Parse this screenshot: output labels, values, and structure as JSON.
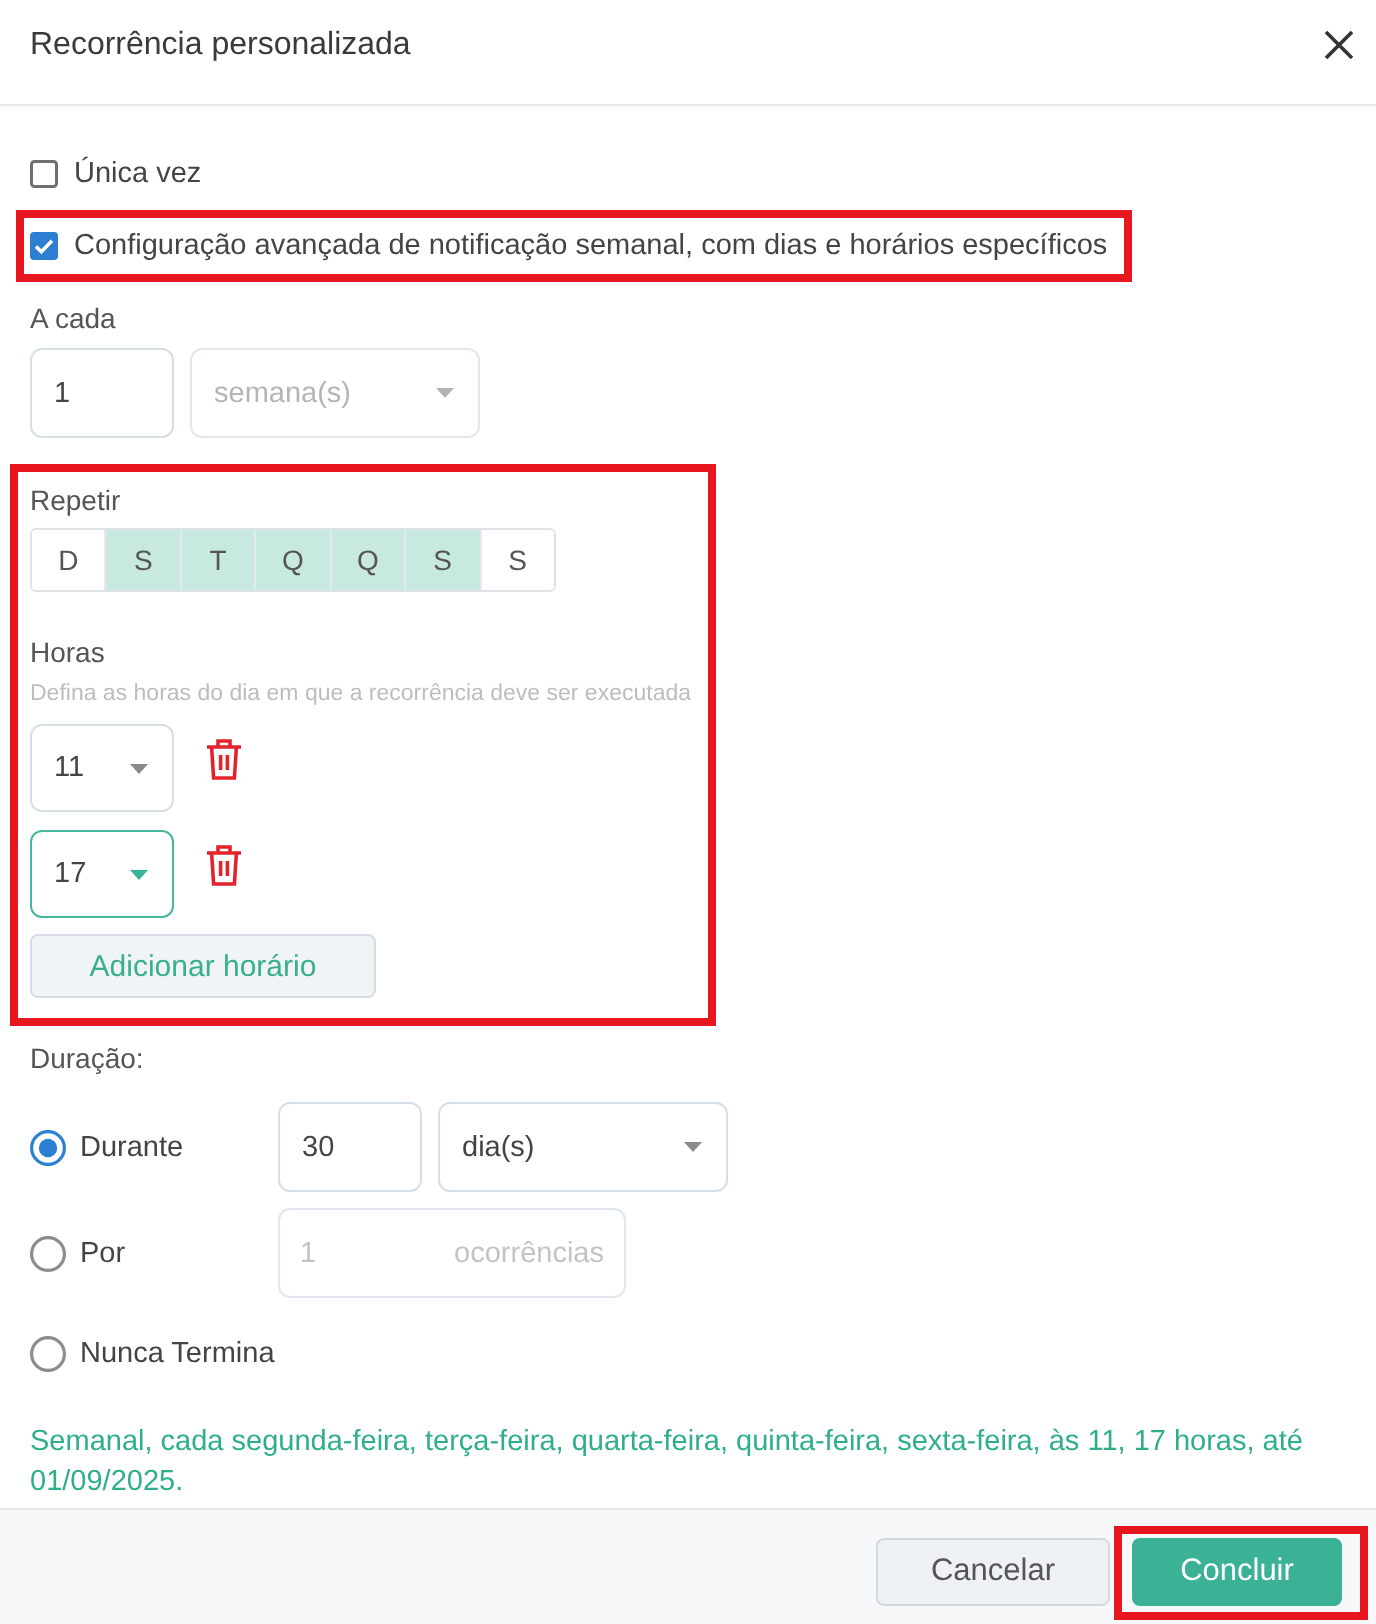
{
  "dialog": {
    "title": "Recorrência personalizada"
  },
  "options": [
    {
      "label": "Única vez",
      "checked": false,
      "highlighted": false
    },
    {
      "label": "Configuração avançada de notificação semanal, com dias e horários específicos",
      "checked": true,
      "highlighted": true
    }
  ],
  "interval": {
    "label": "A cada",
    "value": "1",
    "unit": {
      "value": "semana(s)",
      "disabled": true
    }
  },
  "schedule": {
    "highlighted": true,
    "repeat": {
      "label": "Repetir",
      "days": [
        {
          "label": "D",
          "selected": false
        },
        {
          "label": "S",
          "selected": true
        },
        {
          "label": "T",
          "selected": true
        },
        {
          "label": "Q",
          "selected": true
        },
        {
          "label": "Q",
          "selected": true
        },
        {
          "label": "S",
          "selected": true
        },
        {
          "label": "S",
          "selected": false
        }
      ]
    },
    "hours": {
      "label": "Horas",
      "hint": "Defina as horas do dia em que a recorrência deve ser executada",
      "times": [
        {
          "value": "11",
          "focused": false
        },
        {
          "value": "17",
          "focused": true
        }
      ],
      "add_button": "Adicionar horário"
    }
  },
  "duration": {
    "label": "Duração:",
    "options": [
      {
        "kind": "amount",
        "label": "Durante",
        "selected": true,
        "value": "30",
        "unit": "dia(s)"
      },
      {
        "kind": "occurrences",
        "label": "Por",
        "selected": false,
        "value": "1",
        "suffix": "ocorrências",
        "disabled": true
      },
      {
        "kind": "never",
        "label": "Nunca Termina",
        "selected": false
      }
    ]
  },
  "summary": "Semanal, cada segunda-feira, terça-feira, quarta-feira, quinta-feira, sexta-feira, às 11, 17 horas, até 01/09/2025.",
  "footer": {
    "buttons": [
      {
        "kind": "secondary",
        "label": "Cancelar",
        "highlighted": false
      },
      {
        "kind": "primary",
        "label": "Concluir",
        "highlighted": true
      }
    ]
  }
}
